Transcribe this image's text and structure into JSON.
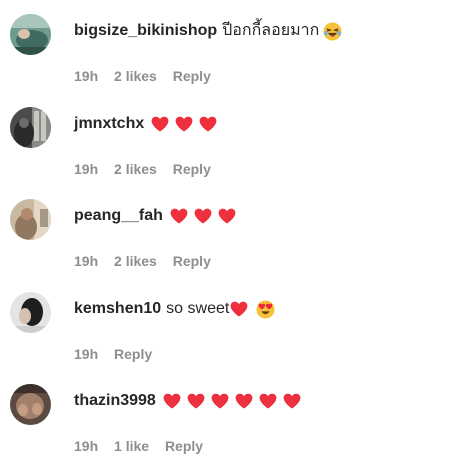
{
  "comments": [
    {
      "username": "bigsize_bikinishop",
      "text": "ปีอกกี้ลอยมาก",
      "emoji": "laughing-face",
      "time": "19h",
      "likes": "2 likes",
      "reply": "Reply"
    },
    {
      "username": "jmnxtchx",
      "hearts": 3,
      "time": "19h",
      "likes": "2 likes",
      "reply": "Reply"
    },
    {
      "username": "peang__fah",
      "hearts": 3,
      "time": "19h",
      "likes": "2 likes",
      "reply": "Reply"
    },
    {
      "username": "kemshen10",
      "text": "so sweet",
      "hearts": 1,
      "emoji": "heart-eyes-face",
      "time": "19h",
      "reply": "Reply"
    },
    {
      "username": "thazin3998",
      "hearts": 6,
      "time": "19h",
      "likes": "1 like",
      "reply": "Reply"
    }
  ],
  "colors": {
    "heart": "#ed2f3e",
    "meta_text": "#8e8e8e",
    "primary_text": "#262626"
  }
}
